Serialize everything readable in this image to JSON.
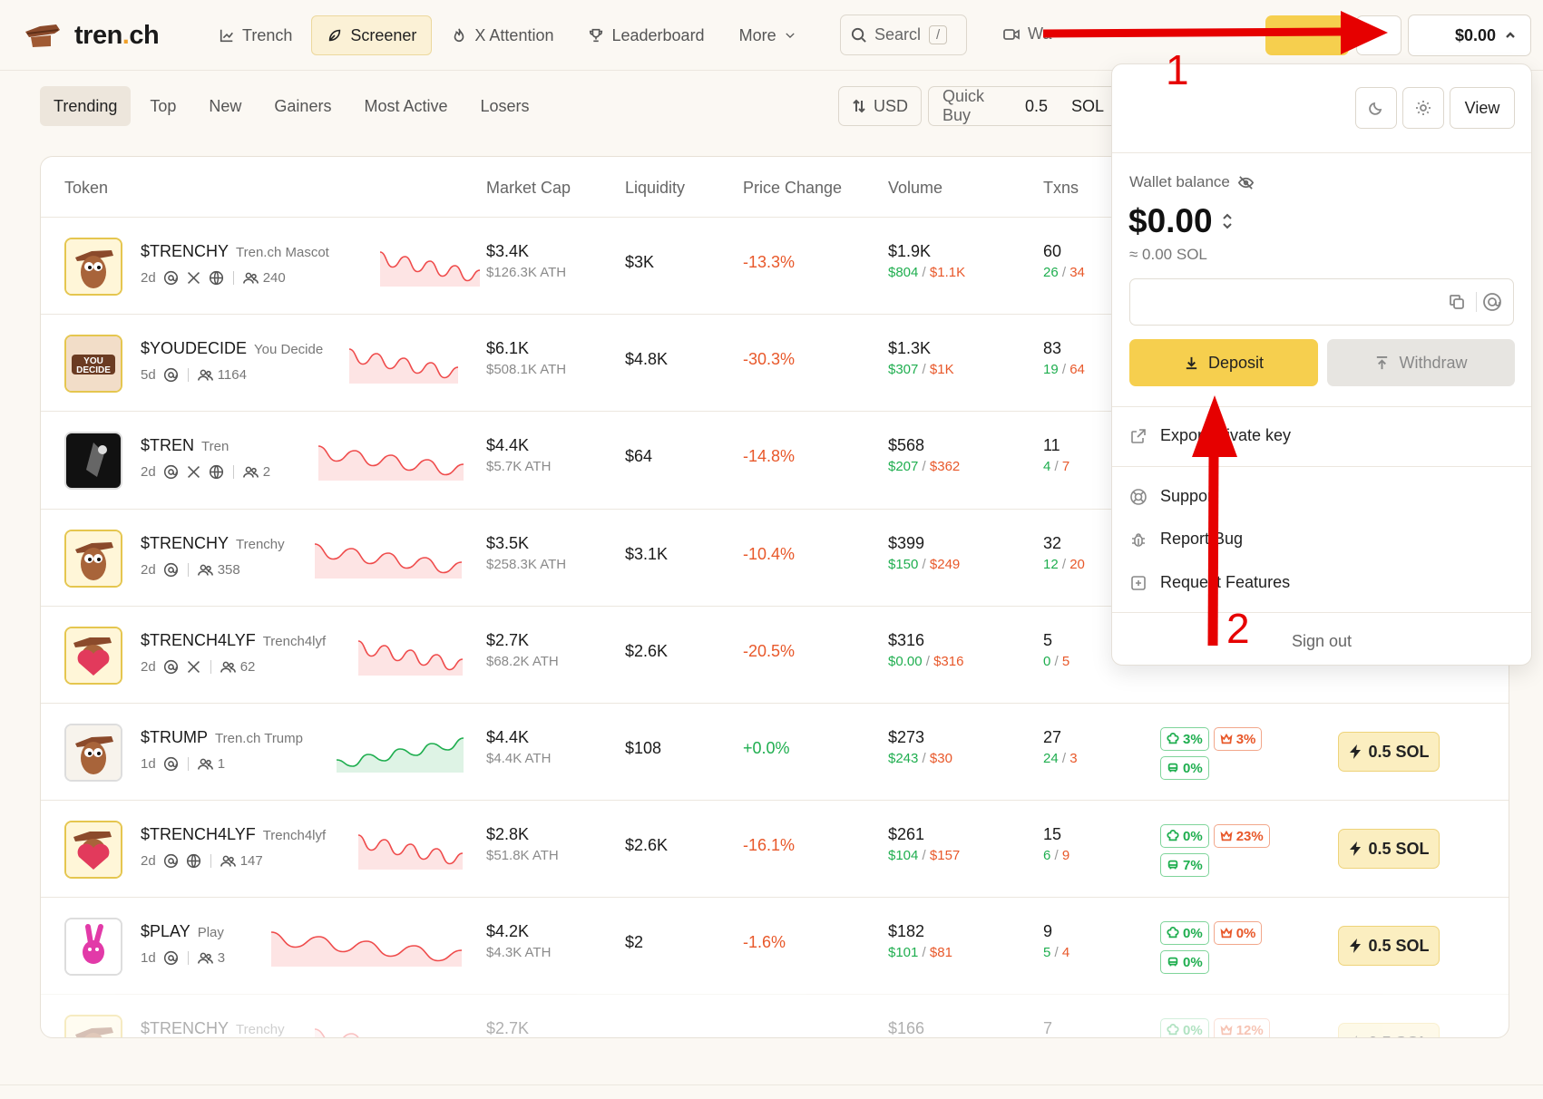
{
  "brand": {
    "name_main": "tren",
    "name_dot": ".",
    "name_tld": "ch"
  },
  "nav": {
    "items": [
      {
        "label": "Trench",
        "icon": "chart-line-icon"
      },
      {
        "label": "Screener",
        "icon": "leaf-icon",
        "active": true
      },
      {
        "label": "X Attention",
        "icon": "flame-icon"
      },
      {
        "label": "Leaderboard",
        "icon": "trophy-icon"
      },
      {
        "label": "More",
        "icon": "chevron-down-icon"
      }
    ],
    "search_placeholder": "Searcl",
    "search_shortcut": "/",
    "watch_label": "Wa",
    "balance": "$0.00"
  },
  "tabs": [
    "Trending",
    "Top",
    "New",
    "Gainers",
    "Most Active",
    "Losers"
  ],
  "toolbar": {
    "currency": "USD",
    "quick_buy_label": "Quick Buy",
    "quick_buy_value": "0.5",
    "quick_buy_unit": "SOL"
  },
  "table": {
    "headers": [
      "Token",
      "Market Cap",
      "Liquidity",
      "Price Change",
      "Volume",
      "Txns"
    ],
    "rows": [
      {
        "symbol": "$TRENCHY",
        "name": "Tren.ch Mascot",
        "age": "2d",
        "holders": "240",
        "mcap": "$3.4K",
        "ath": "$126.3K ATH",
        "liq": "$3K",
        "change": "-13.3%",
        "vol": "$1.9K",
        "buy": "$804",
        "sell": "$1.1K",
        "tx": "60",
        "txb": "26",
        "txs": "34"
      },
      {
        "symbol": "$YOUDECIDE",
        "name": "You Decide",
        "age": "5d",
        "holders": "1164",
        "mcap": "$6.1K",
        "ath": "$508.1K ATH",
        "liq": "$4.8K",
        "change": "-30.3%",
        "vol": "$1.3K",
        "buy": "$307",
        "sell": "$1K",
        "tx": "83",
        "txb": "19",
        "txs": "64"
      },
      {
        "symbol": "$TREN",
        "name": "Tren",
        "age": "2d",
        "holders": "2",
        "mcap": "$4.4K",
        "ath": "$5.7K ATH",
        "liq": "$64",
        "change": "-14.8%",
        "vol": "$568",
        "buy": "$207",
        "sell": "$362",
        "tx": "11",
        "txb": "4",
        "txs": "7"
      },
      {
        "symbol": "$TRENCHY",
        "name": "Trenchy",
        "age": "2d",
        "holders": "358",
        "mcap": "$3.5K",
        "ath": "$258.3K ATH",
        "liq": "$3.1K",
        "change": "-10.4%",
        "vol": "$399",
        "buy": "$150",
        "sell": "$249",
        "tx": "32",
        "txb": "12",
        "txs": "20"
      },
      {
        "symbol": "$TRENCH4LYF",
        "name": "Trench4lyf",
        "age": "2d",
        "holders": "62",
        "mcap": "$2.7K",
        "ath": "$68.2K ATH",
        "liq": "$2.6K",
        "change": "-20.5%",
        "vol": "$316",
        "buy": "$0.00",
        "sell": "$316",
        "tx": "5",
        "txb": "0",
        "txs": "5"
      },
      {
        "symbol": "$TRUMP",
        "name": "Tren.ch Trump",
        "age": "1d",
        "holders": "1",
        "mcap": "$4.4K",
        "ath": "$4.4K ATH",
        "liq": "$108",
        "change": "+0.0%",
        "vol": "$273",
        "buy": "$243",
        "sell": "$30",
        "tx": "27",
        "txb": "24",
        "txs": "3",
        "b1": "3%",
        "b2": "3%",
        "b3": "0%"
      },
      {
        "symbol": "$TRENCH4LYF",
        "name": "Trench4lyf",
        "age": "2d",
        "holders": "147",
        "mcap": "$2.8K",
        "ath": "$51.8K ATH",
        "liq": "$2.6K",
        "change": "-16.1%",
        "vol": "$261",
        "buy": "$104",
        "sell": "$157",
        "tx": "15",
        "txb": "6",
        "txs": "9",
        "b1": "0%",
        "b2": "23%",
        "b3": "7%"
      },
      {
        "symbol": "$PLAY",
        "name": "Play",
        "age": "1d",
        "holders": "3",
        "mcap": "$4.2K",
        "ath": "$4.3K ATH",
        "liq": "$2",
        "change": "-1.6%",
        "vol": "$182",
        "buy": "$101",
        "sell": "$81",
        "tx": "9",
        "txb": "5",
        "txs": "4",
        "b1": "0%",
        "b2": "0%",
        "b3": "0%"
      },
      {
        "symbol": "$TRENCHY",
        "name": "Trenchy",
        "mcap": "$2.7K",
        "vol": "$166",
        "tx": "7",
        "b1": "0%",
        "b2": "12%"
      }
    ],
    "buy_label": "0.5 SOL"
  },
  "wallet": {
    "view_label": "View",
    "balance_label": "Wallet balance",
    "balance": "$0.00",
    "balance_sol": "≈ 0.00 SOL",
    "deposit": "Deposit",
    "withdraw": "Withdraw",
    "export_key": "Export private key",
    "support": "Support",
    "report_bug": "Report Bug",
    "request_features": "Request Features",
    "sign_out": "Sign out"
  },
  "annotations": {
    "step1": "1",
    "step2": "2",
    "arrow_color": "#e60000"
  }
}
